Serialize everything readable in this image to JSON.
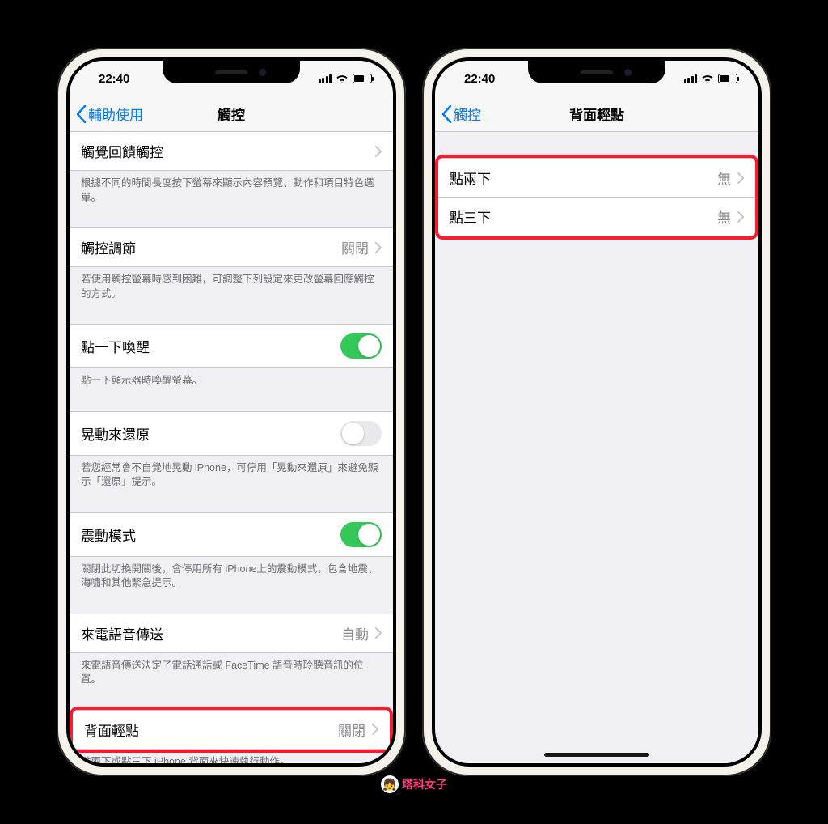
{
  "status": {
    "time": "22:40"
  },
  "phone_left": {
    "nav_back": "輔助使用",
    "nav_title": "觸控",
    "rows": {
      "haptic_touch": "觸覺回饋觸控",
      "haptic_footer": "根據不同的時間長度按下螢幕來顯示內容預覽、動作和項目特色選單。",
      "touch_accom": "觸控調節",
      "touch_accom_value": "關閉",
      "touch_accom_footer": "若使用觸控螢幕時感到困難，可調整下列設定來更改螢幕回應觸控的方式。",
      "tap_wake": "點一下喚醒",
      "tap_wake_footer": "點一下顯示器時喚醒螢幕。",
      "shake_undo": "晃動來還原",
      "shake_undo_footer": "若您經常會不自覺地晃動 iPhone，可停用「晃動來還原」來避免顯示「還原」提示。",
      "vibration": "震動模式",
      "vibration_footer": "關閉此切換開關後，會停用所有 iPhone上的震動模式，包含地震、海嘯和其他緊急提示。",
      "call_audio": "來電語音傳送",
      "call_audio_value": "自動",
      "call_audio_footer": "來電語音傳送決定了電話通話或 FaceTime 語音時聆聽音訊的位置。",
      "back_tap": "背面輕點",
      "back_tap_value": "關閉",
      "back_tap_footer": "點兩下或點三下 iPhone 背面來快速執行動作。"
    }
  },
  "phone_right": {
    "nav_back": "觸控",
    "nav_title": "背面輕點",
    "rows": {
      "double_tap": "點兩下",
      "double_tap_value": "無",
      "triple_tap": "點三下",
      "triple_tap_value": "無"
    }
  },
  "watermark": "塔科女子"
}
